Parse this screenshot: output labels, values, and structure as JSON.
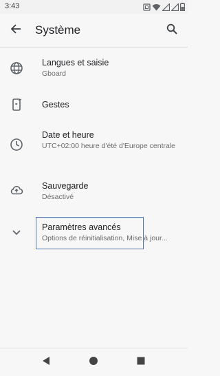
{
  "status_bar": {
    "time": "3:43",
    "icons": [
      "nfc-icon",
      "wifi-icon",
      "signal-icon",
      "signal-icon",
      "battery-icon"
    ]
  },
  "app_bar": {
    "title": "Système"
  },
  "settings": {
    "items": [
      {
        "icon": "globe-icon",
        "title": "Langues et saisie",
        "subtitle": "Gboard"
      },
      {
        "icon": "gesture-phone-icon",
        "title": "Gestes",
        "subtitle": ""
      },
      {
        "icon": "clock-icon",
        "title": "Date et heure",
        "subtitle": "UTC+02:00 heure d'été d'Europe centrale"
      },
      {
        "icon": "cloud-upload-icon",
        "title": "Sauvegarde",
        "subtitle": "Désactivé"
      },
      {
        "icon": "chevron-down-icon",
        "title": "Paramètres avancés",
        "subtitle": "Options de réinitialisation, Mise à jour..."
      }
    ]
  },
  "colors": {
    "background": "#f7f7f7",
    "icon": "#5f6368",
    "focus_border": "#4f72ad"
  },
  "nav_bar": {
    "buttons": [
      "back-triangle-icon",
      "home-circle-icon",
      "recents-square-icon"
    ]
  }
}
